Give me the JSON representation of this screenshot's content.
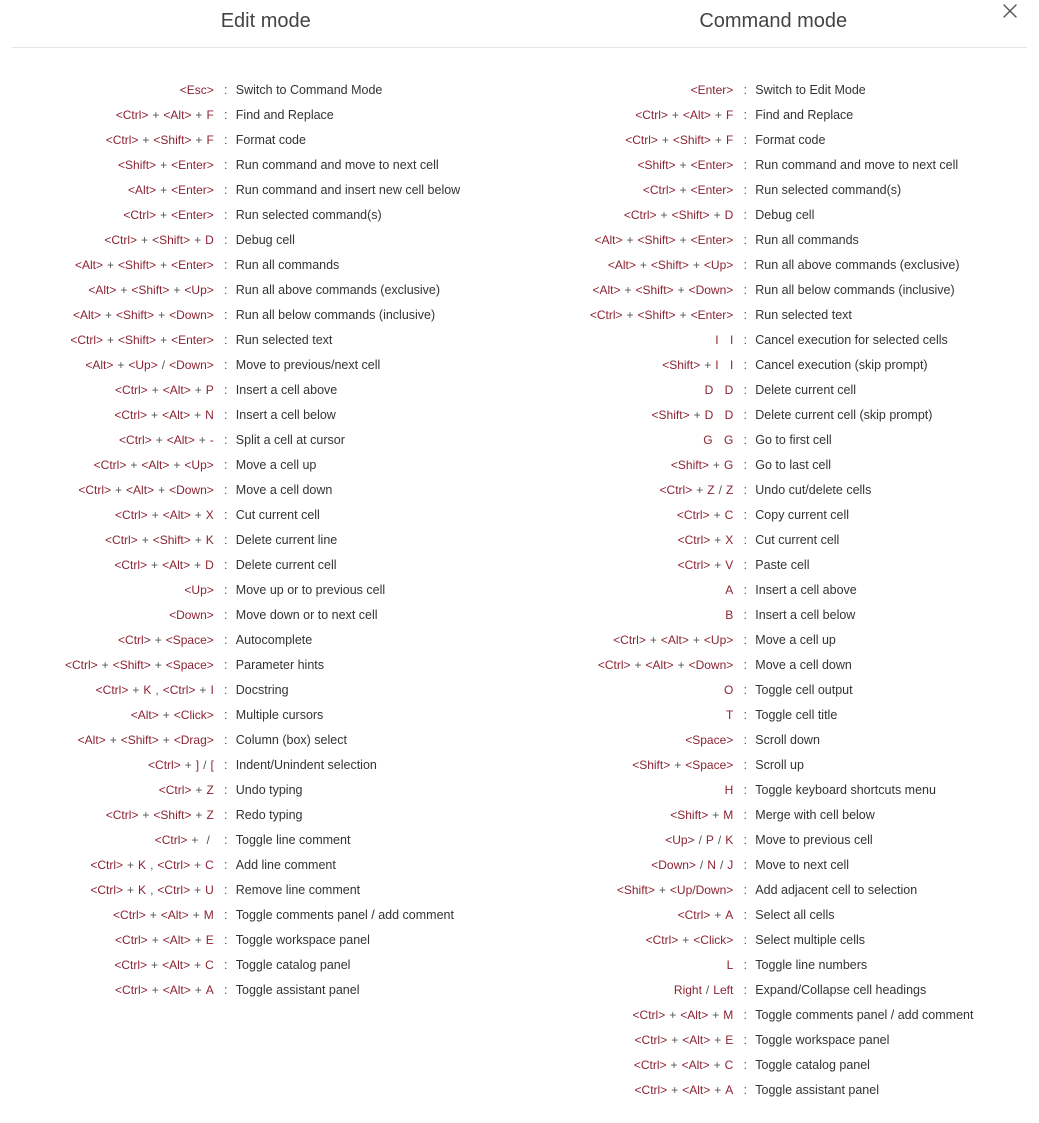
{
  "modes": {
    "edit": {
      "title": "Edit mode",
      "rows": [
        {
          "keys": [
            [
              "<Esc>"
            ]
          ],
          "desc": "Switch to Command Mode"
        },
        {
          "keys": [
            [
              "<Ctrl>",
              "+",
              "<Alt>",
              "+",
              "F"
            ]
          ],
          "desc": "Find and Replace"
        },
        {
          "keys": [
            [
              "<Ctrl>",
              "+",
              "<Shift>",
              "+",
              "F"
            ]
          ],
          "desc": "Format code"
        },
        {
          "keys": [
            [
              "<Shift>",
              "+",
              "<Enter>"
            ]
          ],
          "desc": "Run command and move to next cell"
        },
        {
          "keys": [
            [
              "<Alt>",
              "+",
              "<Enter>"
            ]
          ],
          "desc": "Run command and insert new cell below"
        },
        {
          "keys": [
            [
              "<Ctrl>",
              "+",
              "<Enter>"
            ]
          ],
          "desc": "Run selected command(s)"
        },
        {
          "keys": [
            [
              "<Ctrl>",
              "+",
              "<Shift>",
              "+",
              "D"
            ]
          ],
          "desc": "Debug cell"
        },
        {
          "keys": [
            [
              "<Alt>",
              "+",
              "<Shift>",
              "+",
              "<Enter>"
            ]
          ],
          "desc": "Run all commands"
        },
        {
          "keys": [
            [
              "<Alt>",
              "+",
              "<Shift>",
              "+",
              "<Up>"
            ]
          ],
          "desc": "Run all above commands (exclusive)"
        },
        {
          "keys": [
            [
              "<Alt>",
              "+",
              "<Shift>",
              "+",
              "<Down>"
            ]
          ],
          "desc": "Run all below commands (inclusive)"
        },
        {
          "keys": [
            [
              "<Ctrl>",
              "+",
              "<Shift>",
              "+",
              "<Enter>"
            ]
          ],
          "desc": "Run selected text"
        },
        {
          "keys": [
            [
              "<Alt>",
              "+",
              "<Up>",
              "/",
              "<Down>"
            ]
          ],
          "desc": "Move to previous/next cell"
        },
        {
          "keys": [
            [
              "<Ctrl>",
              "+",
              "<Alt>",
              "+",
              "P"
            ]
          ],
          "desc": "Insert a cell above"
        },
        {
          "keys": [
            [
              "<Ctrl>",
              "+",
              "<Alt>",
              "+",
              "N"
            ]
          ],
          "desc": "Insert a cell below"
        },
        {
          "keys": [
            [
              "<Ctrl>",
              "+",
              "<Alt>",
              "+",
              "-"
            ]
          ],
          "desc": "Split a cell at cursor"
        },
        {
          "keys": [
            [
              "<Ctrl>",
              "+",
              "<Alt>",
              "+",
              "<Up>"
            ]
          ],
          "desc": "Move a cell up"
        },
        {
          "keys": [
            [
              "<Ctrl>",
              "+",
              "<Alt>",
              "+",
              "<Down>"
            ]
          ],
          "desc": "Move a cell down"
        },
        {
          "keys": [
            [
              "<Ctrl>",
              "+",
              "<Alt>",
              "+",
              "X"
            ]
          ],
          "desc": "Cut current cell"
        },
        {
          "keys": [
            [
              "<Ctrl>",
              "+",
              "<Shift>",
              "+",
              "K"
            ]
          ],
          "desc": "Delete current line"
        },
        {
          "keys": [
            [
              "<Ctrl>",
              "+",
              "<Alt>",
              "+",
              "D"
            ]
          ],
          "desc": "Delete current cell"
        },
        {
          "keys": [
            [
              "<Up>"
            ]
          ],
          "desc": "Move up or to previous cell"
        },
        {
          "keys": [
            [
              "<Down>"
            ]
          ],
          "desc": "Move down or to next cell"
        },
        {
          "keys": [
            [
              "<Ctrl>",
              "+",
              "<Space>"
            ]
          ],
          "desc": "Autocomplete"
        },
        {
          "keys": [
            [
              "<Ctrl>",
              "+",
              "<Shift>",
              "+",
              "<Space>"
            ]
          ],
          "desc": "Parameter hints"
        },
        {
          "keys": [
            [
              "<Ctrl>",
              "+",
              "K",
              ",",
              "<Ctrl>",
              "+",
              "I"
            ]
          ],
          "desc": "Docstring"
        },
        {
          "keys": [
            [
              "<Alt>",
              "+",
              "<Click>"
            ]
          ],
          "desc": "Multiple cursors"
        },
        {
          "keys": [
            [
              "<Alt>",
              "+",
              "<Shift>",
              "+",
              "<Drag>"
            ]
          ],
          "desc": "Column (box) select"
        },
        {
          "keys": [
            [
              "<Ctrl>",
              "+",
              "]",
              "/",
              "["
            ]
          ],
          "desc": "Indent/Unindent selection"
        },
        {
          "keys": [
            [
              "<Ctrl>",
              "+",
              "Z"
            ]
          ],
          "desc": "Undo typing"
        },
        {
          "keys": [
            [
              "<Ctrl>",
              "+",
              "<Shift>",
              "+",
              "Z"
            ]
          ],
          "desc": "Redo typing"
        },
        {
          "keys": [
            [
              "<Ctrl>",
              "+",
              "/"
            ]
          ],
          "desc": "Toggle line comment"
        },
        {
          "keys": [
            [
              "<Ctrl>",
              "+",
              "K",
              ",",
              "<Ctrl>",
              "+",
              "C"
            ]
          ],
          "desc": "Add line comment"
        },
        {
          "keys": [
            [
              "<Ctrl>",
              "+",
              "K",
              ",",
              "<Ctrl>",
              "+",
              "U"
            ]
          ],
          "desc": "Remove line comment"
        },
        {
          "keys": [
            [
              "<Ctrl>",
              "+",
              "<Alt>",
              "+",
              "M"
            ]
          ],
          "desc": "Toggle comments panel / add comment"
        },
        {
          "keys": [
            [
              "<Ctrl>",
              "+",
              "<Alt>",
              "+",
              "E"
            ]
          ],
          "desc": "Toggle workspace panel"
        },
        {
          "keys": [
            [
              "<Ctrl>",
              "+",
              "<Alt>",
              "+",
              "C"
            ]
          ],
          "desc": "Toggle catalog panel"
        },
        {
          "keys": [
            [
              "<Ctrl>",
              "+",
              "<Alt>",
              "+",
              "A"
            ]
          ],
          "desc": "Toggle assistant panel"
        }
      ]
    },
    "command": {
      "title": "Command mode",
      "rows": [
        {
          "keys": [
            [
              "<Enter>"
            ]
          ],
          "desc": "Switch to Edit Mode"
        },
        {
          "keys": [
            [
              "<Ctrl>",
              "+",
              "<Alt>",
              "+",
              "F"
            ]
          ],
          "desc": "Find and Replace"
        },
        {
          "keys": [
            [
              "<Ctrl>",
              "+",
              "<Shift>",
              "+",
              "F"
            ]
          ],
          "desc": "Format code"
        },
        {
          "keys": [
            [
              "<Shift>",
              "+",
              "<Enter>"
            ]
          ],
          "desc": "Run command and move to next cell"
        },
        {
          "keys": [
            [
              "<Ctrl>",
              "+",
              "<Enter>"
            ]
          ],
          "desc": "Run selected command(s)"
        },
        {
          "keys": [
            [
              "<Ctrl>",
              "+",
              "<Shift>",
              "+",
              "D"
            ]
          ],
          "desc": "Debug cell"
        },
        {
          "keys": [
            [
              "<Alt>",
              "+",
              "<Shift>",
              "+",
              "<Enter>"
            ]
          ],
          "desc": "Run all commands"
        },
        {
          "keys": [
            [
              "<Alt>",
              "+",
              "<Shift>",
              "+",
              "<Up>"
            ]
          ],
          "desc": "Run all above commands (exclusive)"
        },
        {
          "keys": [
            [
              "<Alt>",
              "+",
              "<Shift>",
              "+",
              "<Down>"
            ]
          ],
          "desc": "Run all below commands (inclusive)"
        },
        {
          "keys": [
            [
              "<Ctrl>",
              "+",
              "<Shift>",
              "+",
              "<Enter>"
            ]
          ],
          "desc": "Run selected text"
        },
        {
          "keys": [
            [
              "I",
              " ",
              "I"
            ]
          ],
          "desc": "Cancel execution for selected cells"
        },
        {
          "keys": [
            [
              "<Shift>",
              "+",
              "I",
              " ",
              "I"
            ]
          ],
          "desc": "Cancel execution (skip prompt)"
        },
        {
          "keys": [
            [
              "D",
              " ",
              "D"
            ]
          ],
          "desc": "Delete current cell"
        },
        {
          "keys": [
            [
              "<Shift>",
              "+",
              "D",
              " ",
              "D"
            ]
          ],
          "desc": "Delete current cell (skip prompt)"
        },
        {
          "keys": [
            [
              "G",
              " ",
              "G"
            ]
          ],
          "desc": "Go to first cell"
        },
        {
          "keys": [
            [
              "<Shift>",
              "+",
              "G"
            ]
          ],
          "desc": "Go to last cell"
        },
        {
          "keys": [
            [
              "<Ctrl>",
              "+",
              "Z",
              "/",
              "Z"
            ]
          ],
          "desc": "Undo cut/delete cells"
        },
        {
          "keys": [
            [
              "<Ctrl>",
              "+",
              "C"
            ]
          ],
          "desc": "Copy current cell"
        },
        {
          "keys": [
            [
              "<Ctrl>",
              "+",
              "X"
            ]
          ],
          "desc": "Cut current cell"
        },
        {
          "keys": [
            [
              "<Ctrl>",
              "+",
              "V"
            ]
          ],
          "desc": "Paste cell"
        },
        {
          "keys": [
            [
              "A"
            ]
          ],
          "desc": "Insert a cell above"
        },
        {
          "keys": [
            [
              "B"
            ]
          ],
          "desc": "Insert a cell below"
        },
        {
          "keys": [
            [
              "<Ctrl>",
              "+",
              "<Alt>",
              "+",
              "<Up>"
            ]
          ],
          "desc": "Move a cell up"
        },
        {
          "keys": [
            [
              "<Ctrl>",
              "+",
              "<Alt>",
              "+",
              "<Down>"
            ]
          ],
          "desc": "Move a cell down"
        },
        {
          "keys": [
            [
              "O"
            ]
          ],
          "desc": "Toggle cell output"
        },
        {
          "keys": [
            [
              "T"
            ]
          ],
          "desc": "Toggle cell title"
        },
        {
          "keys": [
            [
              "<Space>"
            ]
          ],
          "desc": "Scroll down"
        },
        {
          "keys": [
            [
              "<Shift>",
              "+",
              "<Space>"
            ]
          ],
          "desc": "Scroll up"
        },
        {
          "keys": [
            [
              "H"
            ]
          ],
          "desc": "Toggle keyboard shortcuts menu"
        },
        {
          "keys": [
            [
              "<Shift>",
              "+",
              "M"
            ]
          ],
          "desc": "Merge with cell below"
        },
        {
          "keys": [
            [
              "<Up>",
              "/",
              "P",
              "/",
              "K"
            ]
          ],
          "desc": "Move to previous cell"
        },
        {
          "keys": [
            [
              "<Down>",
              "/",
              "N",
              "/",
              "J"
            ]
          ],
          "desc": "Move to next cell"
        },
        {
          "keys": [
            [
              "<Shift>",
              "+",
              "<Up/Down>"
            ]
          ],
          "desc": "Add adjacent cell to selection"
        },
        {
          "keys": [
            [
              "<Ctrl>",
              "+",
              "A"
            ]
          ],
          "desc": "Select all cells"
        },
        {
          "keys": [
            [
              "<Ctrl>",
              "+",
              "<Click>"
            ]
          ],
          "desc": "Select multiple cells"
        },
        {
          "keys": [
            [
              "L"
            ]
          ],
          "desc": "Toggle line numbers"
        },
        {
          "keys": [
            [
              "Right",
              "/",
              "Left"
            ]
          ],
          "desc": "Expand/Collapse cell headings"
        },
        {
          "keys": [
            [
              "<Ctrl>",
              "+",
              "<Alt>",
              "+",
              "M"
            ]
          ],
          "desc": "Toggle comments panel / add comment"
        },
        {
          "keys": [
            [
              "<Ctrl>",
              "+",
              "<Alt>",
              "+",
              "E"
            ]
          ],
          "desc": "Toggle workspace panel"
        },
        {
          "keys": [
            [
              "<Ctrl>",
              "+",
              "<Alt>",
              "+",
              "C"
            ]
          ],
          "desc": "Toggle catalog panel"
        },
        {
          "keys": [
            [
              "<Ctrl>",
              "+",
              "<Alt>",
              "+",
              "A"
            ]
          ],
          "desc": "Toggle assistant panel"
        }
      ]
    }
  }
}
